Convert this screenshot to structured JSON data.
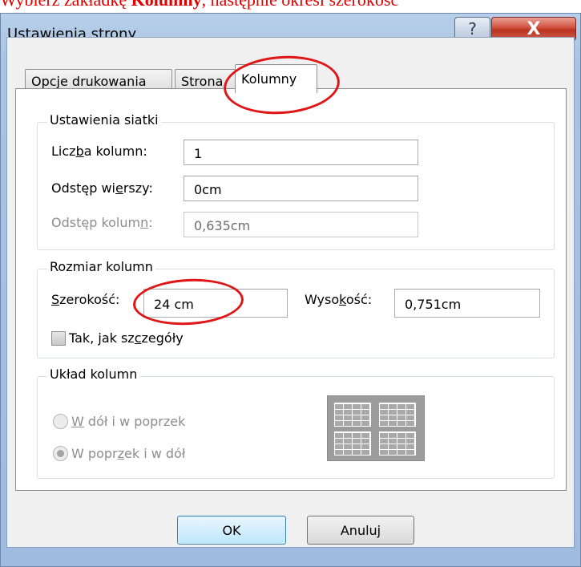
{
  "caption": {
    "part1": "Wybierz zakładkę ",
    "bold": "Kolumny",
    "part2": ", następnie określ szerokość"
  },
  "window": {
    "title": "Ustawienia strony",
    "help_glyph": "?",
    "close_glyph": "X"
  },
  "tabs": [
    {
      "label": "Opcje drukowania"
    },
    {
      "label": "Strona"
    },
    {
      "label": "Kolumny",
      "active": true
    }
  ],
  "grid_settings": {
    "legend": "Ustawienia siatki",
    "column_count": {
      "label_pre": "Licz",
      "label_u": "b",
      "label_post": "a kolumn:",
      "value": "1"
    },
    "row_spacing": {
      "label_pre": "Odstęp wi",
      "label_u": "e",
      "label_post": "rszy:",
      "value": "0cm"
    },
    "column_spacing": {
      "label_pre": "Odstęp kolum",
      "label_u": "n",
      "label_post": ":",
      "value": "0,635cm",
      "disabled": true
    }
  },
  "column_size": {
    "legend": "Rozmiar kolumn",
    "width": {
      "label_pre": "",
      "label_u": "S",
      "label_post": "zerokość:",
      "value": "24 cm"
    },
    "height": {
      "label_pre": "Wyso",
      "label_u": "k",
      "label_post": "ość:",
      "value": "0,751cm"
    },
    "same_as_detail": {
      "label_pre": "Tak, jak sz",
      "label_u": "c",
      "label_post": "zegóły",
      "checked": false
    }
  },
  "column_layout": {
    "legend": "Układ kolumn",
    "down_then_across": {
      "label_u": "W",
      "label_post": " dół i w poprzek",
      "checked": false
    },
    "across_then_down": {
      "label_pre": "W popr",
      "label_u": "z",
      "label_post": "ek i w dół",
      "checked": true
    }
  },
  "buttons": {
    "ok": "OK",
    "cancel": "Anuluj"
  },
  "colors": {
    "annotation": "#e01515",
    "caption": "#e00000"
  }
}
